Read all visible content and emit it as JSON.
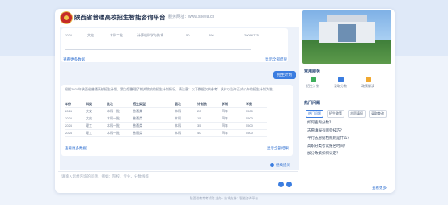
{
  "header": {
    "title": "陕西省普通高校招生智能咨询平台",
    "subtitle": "服务网址：www.sneea.cn"
  },
  "chat": {
    "first_table_row": [
      "2024",
      "文史",
      "本科二批",
      "计算机科学与技术",
      "50",
      "496",
      "20096775"
    ],
    "first_links": {
      "left": "查看更多数据",
      "right": "显示全部结果"
    },
    "user_message": "招生计划",
    "reply_intro": "根据2024年陕西省普通高校招生计划，我为您整理了相关院校的招生计划情况，请注意：以下数据仅供参考，具体以当年正式公布的招生计划为准。",
    "table": {
      "headers": [
        "年份",
        "科类",
        "批次",
        "招生类型",
        "层次",
        "计划数",
        "学制",
        "学费"
      ],
      "rows": [
        [
          "2024",
          "文史",
          "本科一批",
          "普通类",
          "本科",
          "20",
          "四年",
          "5500"
        ],
        [
          "2024",
          "文史",
          "本科一批",
          "普通类",
          "本科",
          "15",
          "四年",
          "5500"
        ],
        [
          "2024",
          "理工",
          "本科一批",
          "普通类",
          "本科",
          "35",
          "四年",
          "5500"
        ],
        [
          "2024",
          "理工",
          "本科一批",
          "普通类",
          "本科",
          "40",
          "四年",
          "5500"
        ]
      ]
    },
    "second_links": {
      "left": "查看更多数据",
      "right": "显示全部结果"
    },
    "mini_button": "继续提问"
  },
  "input": {
    "placeholder": "请输入您想咨询的问题，例如：院校、专业、分数线等"
  },
  "sidebar": {
    "service_title": "常用服务",
    "quick_items": [
      {
        "label": "招生计划",
        "color": "#3fae5c"
      },
      {
        "label": "录取分数",
        "color": "#3b7de0"
      },
      {
        "label": "政策解读",
        "color": "#f0a830"
      }
    ],
    "hot_title": "热门问题",
    "tags": [
      "热门问题",
      "招生政策",
      "志愿填报",
      "录取查询"
    ],
    "questions": [
      "如何查询分数？",
      "志愿填报有哪些技巧？",
      "平行志愿投档规则是什么？",
      "高职分类考试报名时间？",
      "加分政策如何认定？"
    ],
    "more": "查看更多"
  },
  "footer": "陕西省教育考试院 主办 · 技术支持：智能咨询平台"
}
